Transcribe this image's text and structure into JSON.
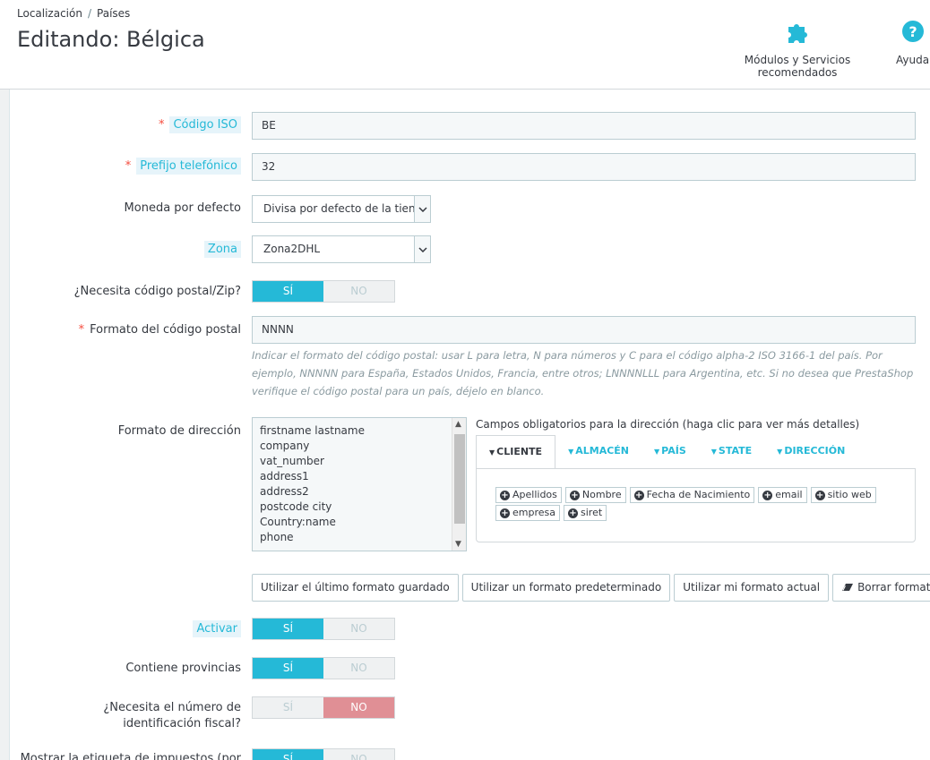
{
  "breadcrumb": {
    "parent": "Localización",
    "sep": "/",
    "current": "Países"
  },
  "page_title": "Editando: Bélgica",
  "toolbar": {
    "modules_label": "Módulos y Servicios recomendados",
    "help_label": "Ayuda"
  },
  "colors": {
    "accent": "#25b9d7",
    "danger": "#e08f95",
    "required": "#f54c3e"
  },
  "form": {
    "iso_code": {
      "label": "Código ISO",
      "value": "BE"
    },
    "phone_prefix": {
      "label": "Prefijo telefónico",
      "value": "32"
    },
    "default_currency": {
      "label": "Moneda por defecto",
      "value": "Divisa por defecto de la tienda"
    },
    "zone": {
      "label": "Zona",
      "value": "Zona2DHL"
    },
    "need_zip": {
      "label": "¿Necesita código postal/Zip?",
      "yes": "SÍ",
      "no": "NO",
      "value": "yes"
    },
    "zip_format": {
      "label": "Formato del código postal",
      "value": "NNNN",
      "help": "Indicar el formato del código postal: usar L para letra, N para números y C para el código alpha-2 ISO 3166-1 del país. Por ejemplo, NNNNN para España, Estados Unidos, Francia, entre otros; LNNNNLLL para Argentina, etc. Si no desea que PrestaShop verifique el código postal para un país, déjelo en blanco."
    },
    "address_format": {
      "label": "Formato de dirección",
      "lines": [
        "firstname lastname",
        "company",
        "vat_number",
        "address1",
        "address2",
        "postcode city",
        "Country:name",
        "phone"
      ]
    },
    "required_fields": {
      "title": "Campos obligatorios para la dirección (haga clic para ver más detalles)",
      "tabs": [
        "CLIENTE",
        "ALMACÉN",
        "PAÍS",
        "STATE",
        "DIRECCIÓN"
      ],
      "chips": [
        "Apellidos",
        "Nombre",
        "Fecha de Nacimiento",
        "email",
        "sitio web",
        "empresa",
        "siret"
      ]
    },
    "format_buttons": {
      "last_saved": "Utilizar el último formato guardado",
      "default": "Utilizar un formato predeterminado",
      "current": "Utilizar mi formato actual",
      "clear": "Borrar formato"
    },
    "active": {
      "label": "Activar",
      "yes": "SÍ",
      "no": "NO",
      "value": "yes"
    },
    "contains_states": {
      "label": "Contiene provincias",
      "yes": "SÍ",
      "no": "NO",
      "value": "yes"
    },
    "need_tax_id": {
      "label": "¿Necesita el número de identificación fiscal?",
      "yes": "SÍ",
      "no": "NO",
      "value": "no"
    },
    "display_tax_label": {
      "label": "Mostrar la etiqueta de impuestos (por",
      "yes": "SÍ",
      "no": "NO",
      "value": "yes"
    }
  }
}
